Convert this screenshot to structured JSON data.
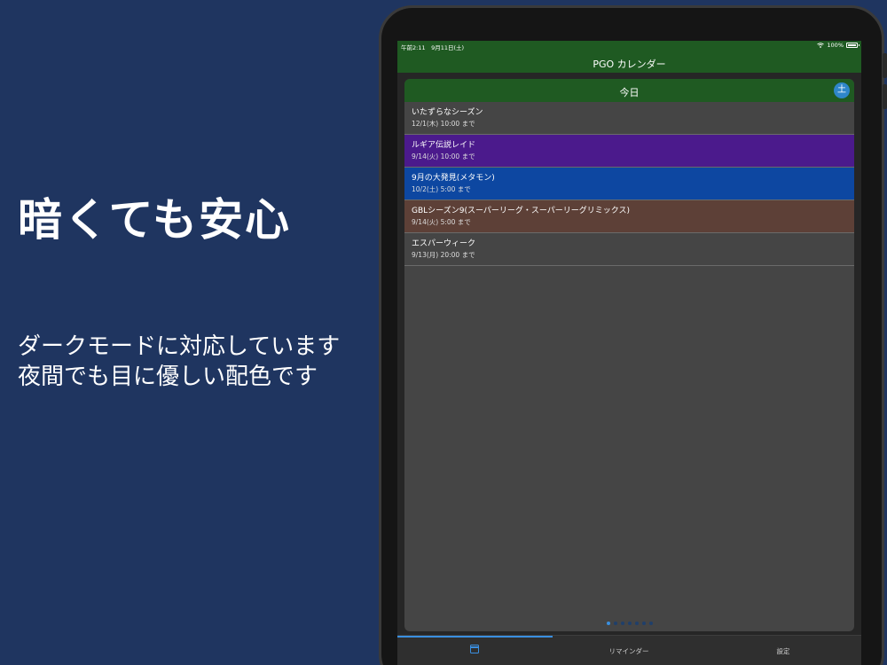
{
  "promo": {
    "title": "暗くても安心",
    "subtitle_lines": [
      "ダークモードに対応しています",
      "夜間でも目に優しい配色です"
    ]
  },
  "status_bar": {
    "time_date": "午前2:11　9月11日(土)",
    "battery": "100%"
  },
  "app": {
    "title": "PGO カレンダー"
  },
  "card": {
    "header_title": "今日",
    "day_badge": "土"
  },
  "events": [
    {
      "title": "いたずらなシーズン",
      "date": "12/1(木) 10:00 まで",
      "color": "#454545"
    },
    {
      "title": "ルギア伝説レイド",
      "date": "9/14(火) 10:00 まで",
      "color": "#4b1a8c"
    },
    {
      "title": "9月の大発見(メタモン)",
      "date": "10/2(土) 5:00 まで",
      "color": "#0d47a1"
    },
    {
      "title": "GBLシーズン9(スーパーリーグ・スーパーリーグリミックス)",
      "date": "9/14(火) 5:00 まで",
      "color": "#5d4037"
    },
    {
      "title": "エスパーウィーク",
      "date": "9/13(月) 20:00 まで",
      "color": "#454545"
    }
  ],
  "pager": {
    "count": 7,
    "active_index": 0
  },
  "tabs": [
    {
      "label": "",
      "icon": "calendar-icon",
      "active": true
    },
    {
      "label": "リマインダー",
      "active": false
    },
    {
      "label": "設定",
      "active": false
    }
  ],
  "colors": {
    "background": "#1f3560",
    "header_green": "#1f5a22",
    "accent_blue": "#3a8fe0"
  }
}
